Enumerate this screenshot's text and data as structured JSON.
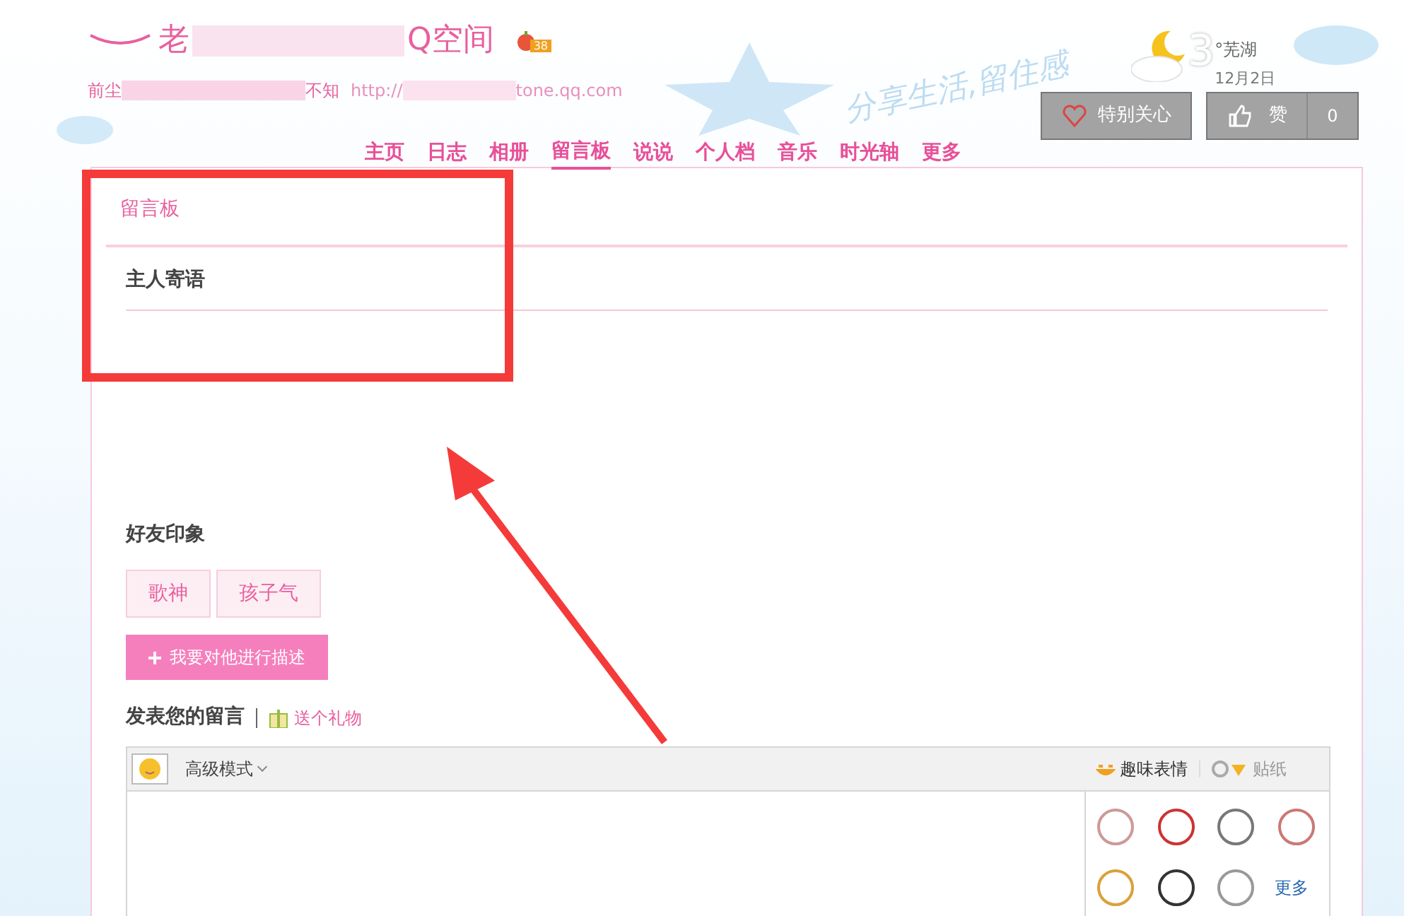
{
  "header": {
    "title_start": "老",
    "title_end": "Q空间",
    "level_badge": "38",
    "subtitle_start": "前尘",
    "subtitle_end": "不知",
    "url_start": "http://",
    "url_end": "tone.qq.com",
    "slogan": "分享生活,留住感"
  },
  "weather": {
    "temperature": "3",
    "unit_city": "°芜湖",
    "date": "12月2日"
  },
  "actions": {
    "follow": "特别关心",
    "like": "赞",
    "like_count": "0"
  },
  "nav": [
    {
      "label": "主页",
      "selected": false
    },
    {
      "label": "日志",
      "selected": false
    },
    {
      "label": "相册",
      "selected": false
    },
    {
      "label": "留言板",
      "selected": true
    },
    {
      "label": "说说",
      "selected": false
    },
    {
      "label": "个人档",
      "selected": false
    },
    {
      "label": "音乐",
      "selected": false
    },
    {
      "label": "时光轴",
      "selected": false
    },
    {
      "label": "更多",
      "selected": false
    }
  ],
  "board": {
    "title": "留言板",
    "owner_note_heading": "主人寄语"
  },
  "impressions": {
    "heading": "好友印象",
    "tags": [
      "歌神",
      "孩子气"
    ],
    "describe_button": "我要对他进行描述"
  },
  "compose": {
    "heading": "发表您的留言",
    "gift_link": "送个礼物",
    "mode": "高级模式",
    "fun_tab": "趣味表情",
    "sticker_tab": "贴纸",
    "more_link": "更多"
  }
}
